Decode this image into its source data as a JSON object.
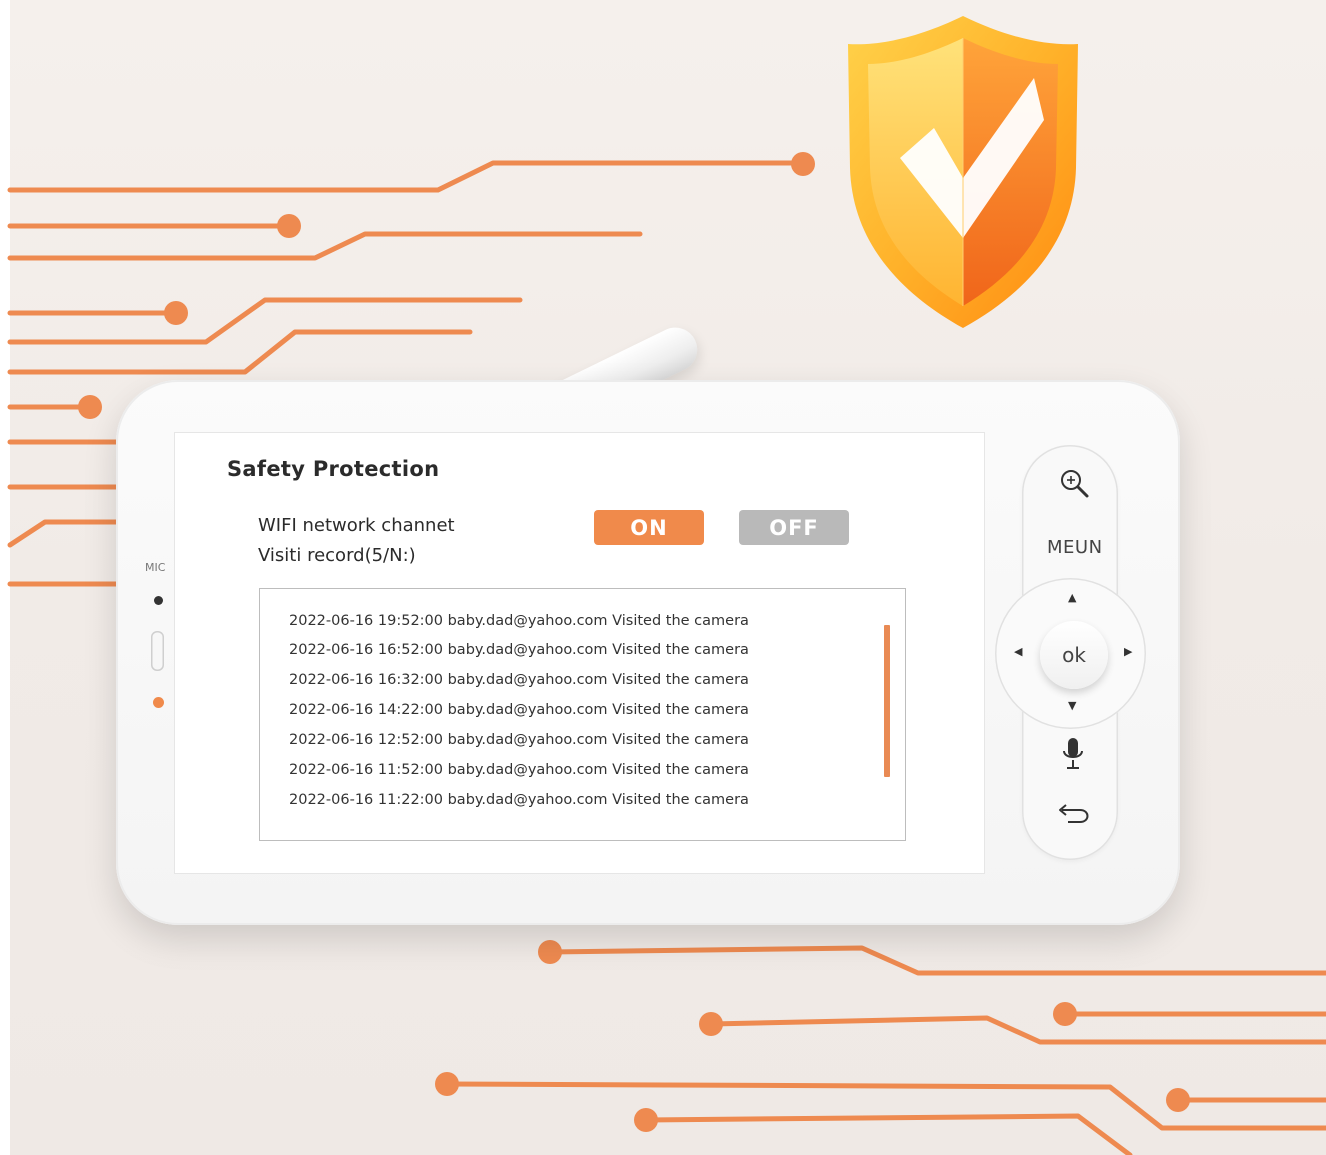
{
  "screen": {
    "title": "Safety Protection",
    "label_wifi": "WIFI network channet",
    "label_visit": "Visiti record(5/N:)",
    "btn_on": "ON",
    "btn_off": "OFF",
    "records": [
      "2022-06-16 19:52:00 baby.dad@yahoo.com Visited the camera",
      "2022-06-16 16:52:00 baby.dad@yahoo.com Visited the camera",
      "2022-06-16 16:32:00 baby.dad@yahoo.com Visited the camera",
      "2022-06-16 14:22:00 baby.dad@yahoo.com Visited the camera",
      "2022-06-16 12:52:00 baby.dad@yahoo.com Visited the camera",
      "2022-06-16 11:52:00 baby.dad@yahoo.com Visited the camera",
      "2022-06-16 11:22:00 baby.dad@yahoo.com Visited the camera"
    ]
  },
  "device": {
    "mic_label": "MIC",
    "menu_label": "MEUN",
    "ok_label": "ok"
  },
  "icons": {
    "zoom": "zoom-in-icon",
    "up": "arrow-up-icon",
    "down": "arrow-down-icon",
    "left": "arrow-left-icon",
    "right": "arrow-right-icon",
    "mic": "microphone-icon",
    "back": "back-icon",
    "shield": "shield-check-icon"
  },
  "colors": {
    "accent": "#f08a4b",
    "off_button": "#b9b9b9",
    "circuit": "#ee8a50"
  }
}
